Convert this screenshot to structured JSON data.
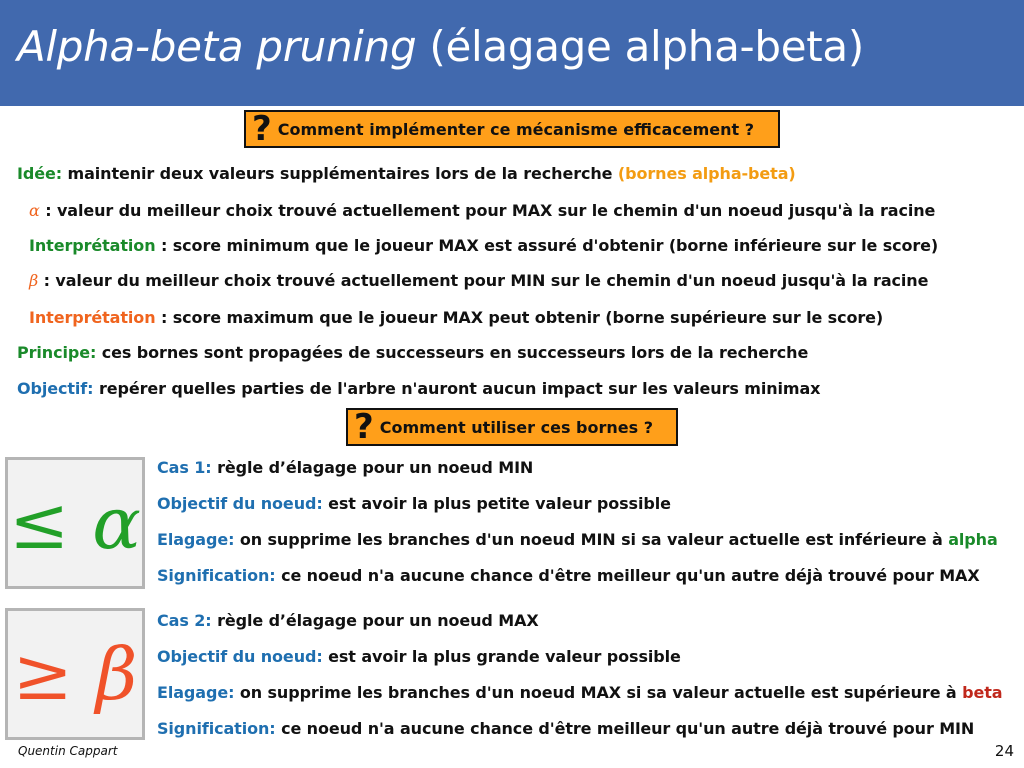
{
  "title": {
    "italic": "Alpha-beta pruning",
    "normal": "(élagage alpha-beta)"
  },
  "question1": {
    "mark": "?",
    "text": "Comment implémenter ce mécanisme efficacement ?"
  },
  "idee": {
    "label": "Idée:",
    "text": "maintenir deux valeurs supplémentaires lors de la recherche",
    "highlight": "(bornes alpha-beta)"
  },
  "alpha_def": {
    "symbol": "α",
    "text": ": valeur du meilleur choix trouvé actuellement pour MAX sur le chemin d'un noeud jusqu'à la racine"
  },
  "alpha_interp": {
    "label": "Interprétation",
    "text": ": score minimum que le joueur MAX est assuré d'obtenir (borne inférieure sur le score)"
  },
  "beta_def": {
    "symbol": "β",
    "text": ": valeur du meilleur choix trouvé actuellement pour MIN sur le chemin d'un noeud jusqu'à la racine"
  },
  "beta_interp": {
    "label": "Interprétation",
    "text": ": score maximum que le joueur MAX peut obtenir (borne supérieure sur le score)"
  },
  "principe": {
    "label": "Principe:",
    "text": "ces bornes sont propagées de successeurs en successeurs lors de la recherche"
  },
  "objectif": {
    "label": "Objectif:",
    "text": "repérer quelles parties de l'arbre n'auront aucun impact sur les valeurs minimax"
  },
  "question2": {
    "mark": "?",
    "text": "Comment utiliser ces bornes ?"
  },
  "cas1": {
    "symbol": "≤ α",
    "cas_label": "Cas 1:",
    "cas_text": "règle d’élagage pour un noeud MIN",
    "obj_label": "Objectif du noeud:",
    "obj_text": "est avoir la plus petite valeur possible",
    "elag_label": "Elagage:",
    "elag_text": "on supprime les branches d'un noeud MIN si sa valeur actuelle est inférieure à",
    "elag_highlight": "alpha",
    "sig_label": "Signification:",
    "sig_text": "ce noeud n'a aucune chance d'être meilleur qu'un autre déjà trouvé pour MAX"
  },
  "cas2": {
    "symbol": "≥ β",
    "cas_label": "Cas 2:",
    "cas_text": "règle d’élagage pour un noeud MAX",
    "obj_label": "Objectif du noeud:",
    "obj_text": "est avoir la plus grande valeur possible",
    "elag_label": "Elagage:",
    "elag_text": "on supprime les branches d'un noeud MAX si sa valeur actuelle est supérieure à",
    "elag_highlight": "beta",
    "sig_label": "Signification:",
    "sig_text": "ce noeud n'a aucune chance d'être meilleur qu'un autre déjà trouvé pour MIN"
  },
  "footer": {
    "author": "Quentin Cappart",
    "page": "24"
  }
}
